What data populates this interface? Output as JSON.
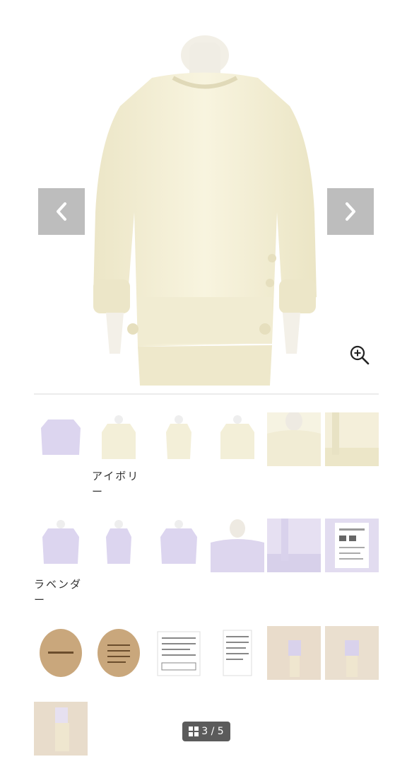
{
  "gallery": {
    "prev_icon": "chevron-left-icon",
    "next_icon": "chevron-right-icon",
    "zoom_icon": "zoom-in-icon",
    "colors": {
      "ivory": "#f6f2dc",
      "lavender": "#dcd6ee",
      "arrow_bg": "#bdbdbd"
    }
  },
  "thumbnails": {
    "row1_label": "アイボリー",
    "row2_label": "ラベンダー"
  },
  "counter": {
    "icon": "grid-icon",
    "text": "3 / 5"
  }
}
